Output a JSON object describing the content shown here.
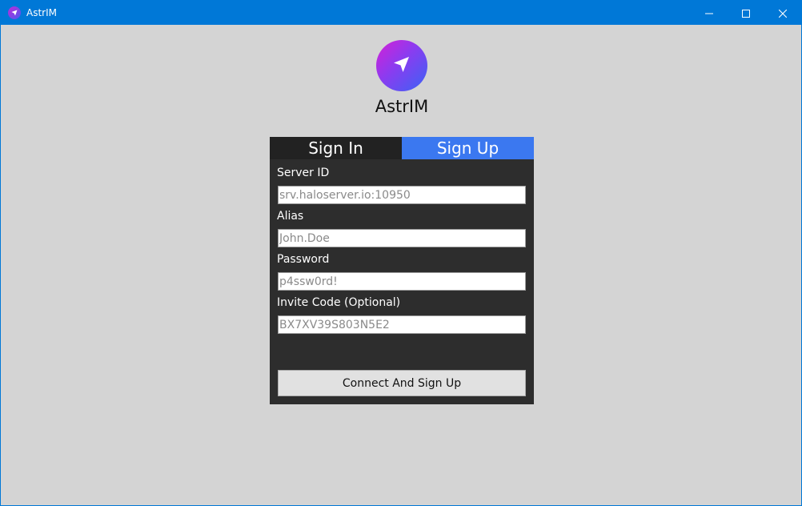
{
  "window": {
    "title": "AstrIM",
    "titlebar_color": "#0078d7",
    "background_color": "#d4d4d4",
    "icon": "paper-plane-icon",
    "controls": {
      "minimize_icon": "minimize-icon",
      "maximize_icon": "maximize-icon",
      "close_icon": "close-icon"
    }
  },
  "app": {
    "name": "AstrIM",
    "logo_icon": "paper-plane-icon",
    "gradient_colors": [
      "#d61fd6",
      "#3a63f5"
    ]
  },
  "tabs": [
    {
      "label": "Sign In",
      "active": false,
      "color": "#222222"
    },
    {
      "label": "Sign Up",
      "active": true,
      "color": "#3b78f0"
    }
  ],
  "form": {
    "panel_color": "#2d2d2d",
    "fields": [
      {
        "label": "Server ID",
        "value": "",
        "placeholder": "srv.haloserver.io:10950"
      },
      {
        "label": "Alias",
        "value": "",
        "placeholder": "John.Doe"
      },
      {
        "label": "Password",
        "value": "",
        "placeholder": "p4ssw0rd!"
      },
      {
        "label": "Invite Code (Optional)",
        "value": "",
        "placeholder": "BX7XV39S803N5E2"
      }
    ],
    "submit_label": "Connect And Sign Up"
  }
}
